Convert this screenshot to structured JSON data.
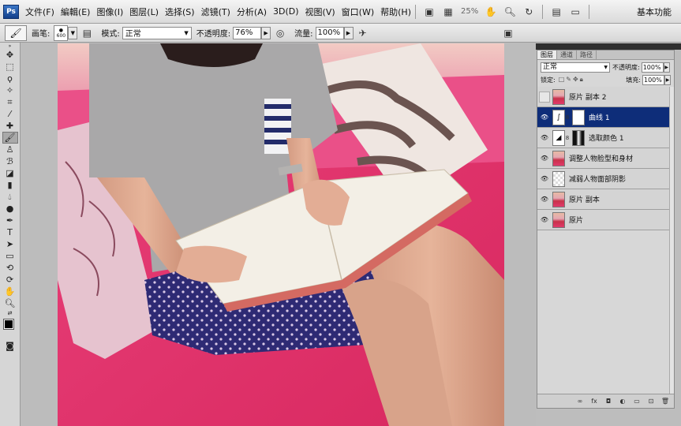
{
  "menubar": {
    "logo": "Ps",
    "items": [
      "文件(F)",
      "編輯(E)",
      "图像(I)",
      "图层(L)",
      "选择(S)",
      "滤镜(T)",
      "分析(A)",
      "3D(D)",
      "视图(V)",
      "窗口(W)",
      "帮助(H)"
    ],
    "zoom": "25%",
    "workspace": "基本功能"
  },
  "options": {
    "brush_label": "画笔:",
    "brush_size": "600",
    "mode_label": "模式:",
    "mode_value": "正常",
    "opacity_label": "不透明度:",
    "opacity_value": "76%",
    "flow_label": "流量:",
    "flow_value": "100%"
  },
  "layers_panel": {
    "tabs": [
      "图层",
      "通道",
      "路径"
    ],
    "blend_mode": "正常",
    "opacity_label": "不透明度:",
    "opacity_value": "100%",
    "lock_label": "锁定:",
    "fill_label": "填充:",
    "fill_value": "100%",
    "layers": [
      {
        "name": "原片 副本 2",
        "visible": false,
        "selected": false
      },
      {
        "name": "曲线 1",
        "visible": true,
        "selected": true
      },
      {
        "name": "选取颜色 1",
        "visible": true,
        "selected": false
      },
      {
        "name": "调整人物脸型和身材",
        "visible": true,
        "selected": false
      },
      {
        "name": "减弱人物面部阴影",
        "visible": true,
        "selected": false
      },
      {
        "name": "原片 副本",
        "visible": true,
        "selected": false
      },
      {
        "name": "原片",
        "visible": true,
        "selected": false
      }
    ]
  },
  "colors": {
    "accent": "#0e2d79",
    "foreground": "#000000",
    "background": "#ffffff"
  }
}
